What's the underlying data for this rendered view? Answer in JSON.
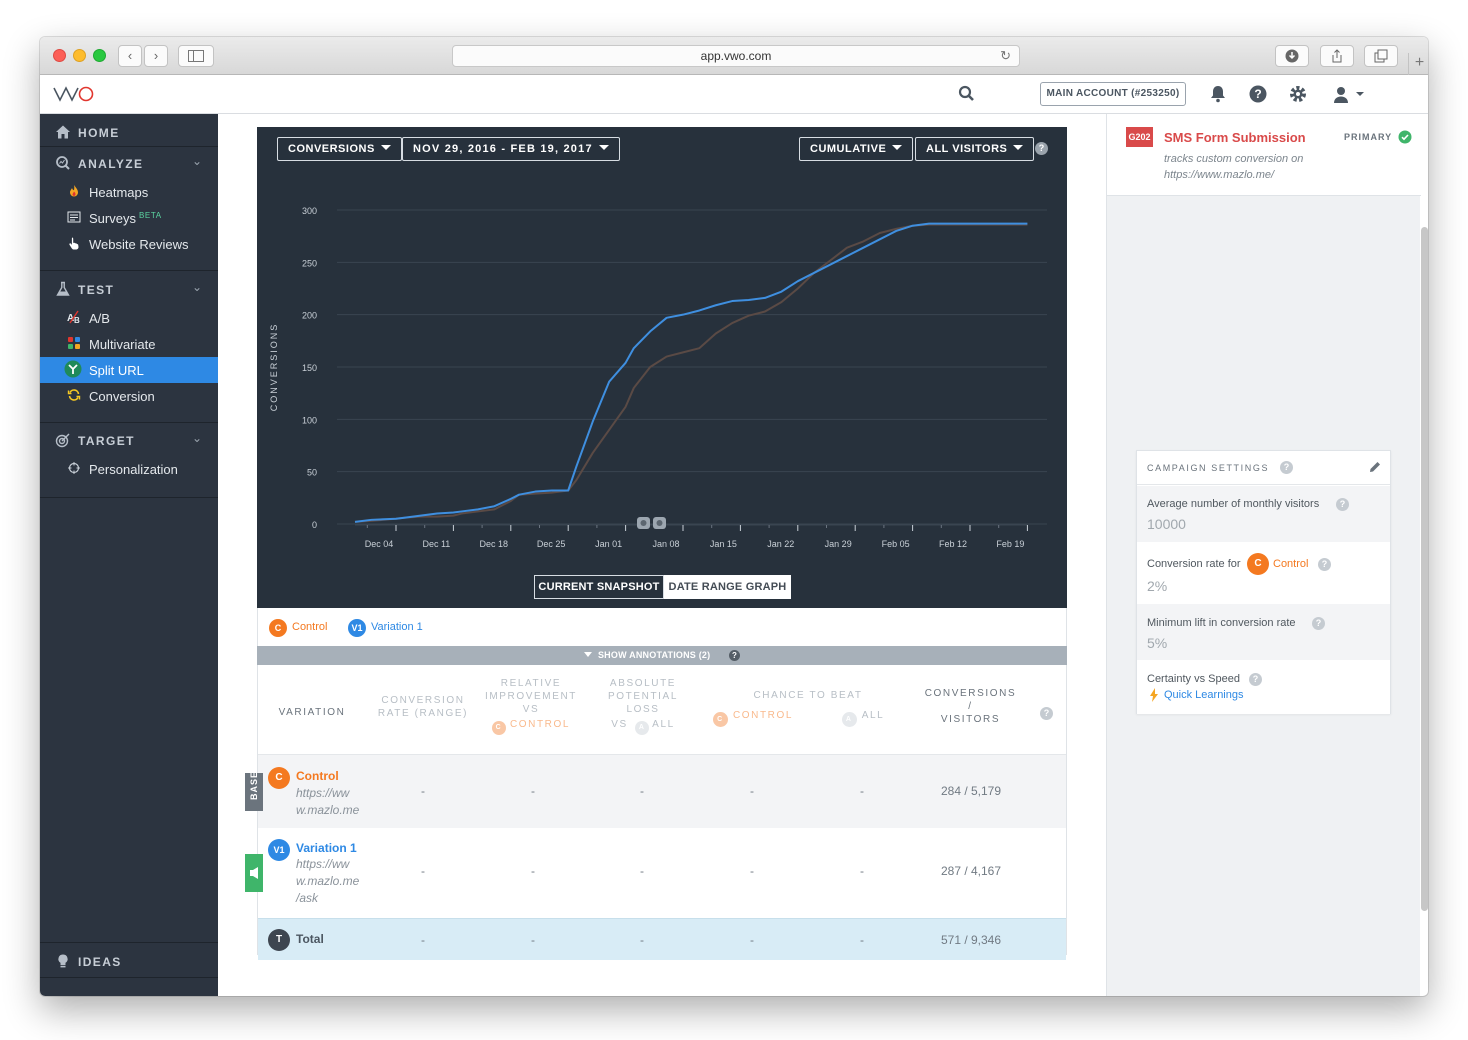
{
  "browser": {
    "url": "app.vwo.com"
  },
  "header": {
    "logo_text": "VWO",
    "account_label": "MAIN ACCOUNT (#253250)"
  },
  "sidebar": {
    "home": "HOME",
    "analyze": {
      "label": "ANALYZE",
      "items": [
        {
          "label": "Heatmaps"
        },
        {
          "label": "Surveys",
          "badge": "BETA"
        },
        {
          "label": "Website Reviews"
        }
      ]
    },
    "test": {
      "label": "TEST",
      "items": [
        {
          "label": "A/B"
        },
        {
          "label": "Multivariate"
        },
        {
          "label": "Split URL"
        },
        {
          "label": "Conversion"
        }
      ]
    },
    "target": {
      "label": "TARGET",
      "items": [
        {
          "label": "Personalization"
        }
      ]
    },
    "ideas": "IDEAS"
  },
  "chart_controls": {
    "metric": "CONVERSIONS",
    "date_range": "NOV 29, 2016 - FEB 19, 2017",
    "mode": "CUMULATIVE",
    "segment": "ALL VISITORS",
    "view_current": "CURRENT SNAPSHOT",
    "view_range": "DATE RANGE GRAPH"
  },
  "chart_data": {
    "type": "line",
    "ylabel": "CONVERSIONS",
    "ylim": [
      0,
      300
    ],
    "yticks": [
      "0",
      "50",
      "100",
      "150",
      "200",
      "250",
      "300"
    ],
    "xticks": [
      "Dec 04",
      "Dec 11",
      "Dec 18",
      "Dec 25",
      "Jan 01",
      "Jan 08",
      "Jan 15",
      "Jan 22",
      "Jan 29",
      "Feb 05",
      "Feb 12",
      "Feb 19"
    ],
    "x": [
      "Nov 29",
      "Dec 01",
      "Dec 04",
      "Dec 05",
      "Dec 07",
      "Dec 09",
      "Dec 11",
      "Dec 12",
      "Dec 14",
      "Dec 16",
      "Dec 18",
      "Dec 19",
      "Dec 21",
      "Dec 23",
      "Dec 25",
      "Dec 26",
      "Dec 28",
      "Dec 30",
      "Jan 01",
      "Jan 02",
      "Jan 04",
      "Jan 06",
      "Jan 08",
      "Jan 10",
      "Jan 12",
      "Jan 14",
      "Jan 16",
      "Jan 18",
      "Jan 20",
      "Jan 22",
      "Jan 24",
      "Jan 26",
      "Jan 28",
      "Jan 30",
      "Feb 01",
      "Feb 03",
      "Feb 05",
      "Feb 07",
      "Feb 09",
      "Feb 11",
      "Feb 13",
      "Feb 15",
      "Feb 17",
      "Feb 19"
    ],
    "series": [
      {
        "name": "Control",
        "color": "#5a4a45",
        "values": [
          2,
          3,
          5,
          6,
          7,
          7,
          8,
          10,
          12,
          14,
          22,
          28,
          29,
          30,
          32,
          42,
          68,
          90,
          112,
          130,
          150,
          160,
          164,
          168,
          182,
          192,
          199,
          203,
          212,
          225,
          240,
          252,
          264,
          270,
          278,
          282,
          285,
          286,
          286,
          286,
          286,
          286,
          286,
          286
        ]
      },
      {
        "name": "Variation 1",
        "color": "#3f8fe0",
        "values": [
          2,
          4,
          5,
          6,
          8,
          10,
          11,
          12,
          14,
          17,
          24,
          28,
          31,
          32,
          32,
          55,
          98,
          136,
          154,
          168,
          184,
          197,
          200,
          204,
          209,
          213,
          214,
          216,
          222,
          232,
          240,
          248,
          256,
          264,
          272,
          280,
          285,
          287,
          287,
          287,
          287,
          287,
          287,
          287
        ]
      }
    ],
    "annotation_markers": 2,
    "colors": {
      "background": "#27313c",
      "grid": "#3a4551",
      "axis_text": "#c9d0d7"
    }
  },
  "legend": {
    "control": {
      "badge": "C",
      "label": "Control",
      "color": "#f47920"
    },
    "variation": {
      "badge": "V1",
      "label": "Variation 1",
      "color": "#2e89e4"
    }
  },
  "annotations_toggle": "SHOW ANNOTATIONS (2)",
  "table": {
    "headers": {
      "variation": "VARIATION",
      "conv_rate": [
        "CONVERSION",
        "RATE (RANGE)"
      ],
      "improvement": [
        "RELATIVE",
        "IMPROVEMENT",
        "VS"
      ],
      "improvement_vs": "CONTROL",
      "loss": [
        "ABSOLUTE",
        "POTENTIAL",
        "LOSS"
      ],
      "loss_vs": "VS",
      "loss_all": "ALL",
      "chance": "CHANCE TO BEAT",
      "chance_control": "CONTROL",
      "chance_all": "ALL",
      "conversions": [
        "CONVERSIONS",
        "/",
        "VISITORS"
      ]
    },
    "rows": [
      {
        "badge": "C",
        "name": "Control",
        "url": [
          "https://ww",
          "w.mazlo.me"
        ],
        "tag": "BASE",
        "conv_rate": "-",
        "improvement": "-",
        "loss": "-",
        "chance_control": "-",
        "chance_all": "-",
        "conversions": "284 / 5,179"
      },
      {
        "badge": "V1",
        "name": "Variation 1",
        "url": [
          "https://ww",
          "w.mazlo.me",
          "/ask"
        ],
        "conv_rate": "-",
        "improvement": "-",
        "loss": "-",
        "chance_control": "-",
        "chance_all": "-",
        "conversions": "287 / 4,167"
      },
      {
        "badge": "T",
        "name": "Total",
        "conv_rate": "-",
        "improvement": "-",
        "loss": "-",
        "chance_control": "-",
        "chance_all": "-",
        "conversions": "571 / 9,346"
      }
    ]
  },
  "goal": {
    "id": "G202",
    "name": "SMS Form Submission",
    "description": [
      "tracks custom conversion on",
      "https://www.mazlo.me/"
    ],
    "status": "PRIMARY"
  },
  "campaign_settings": {
    "title": "CAMPAIGN SETTINGS",
    "avg_visitors_label": "Average number of monthly visitors",
    "avg_visitors_value": "10000",
    "conv_rate_label": "Conversion rate for",
    "conv_rate_badge": "C",
    "conv_rate_ref": "Control",
    "conv_rate_value": "2%",
    "min_lift_label": "Minimum lift in conversion rate",
    "min_lift_value": "5%",
    "certainty_label": "Certainty vs Speed",
    "certainty_value": "Quick Learnings"
  }
}
